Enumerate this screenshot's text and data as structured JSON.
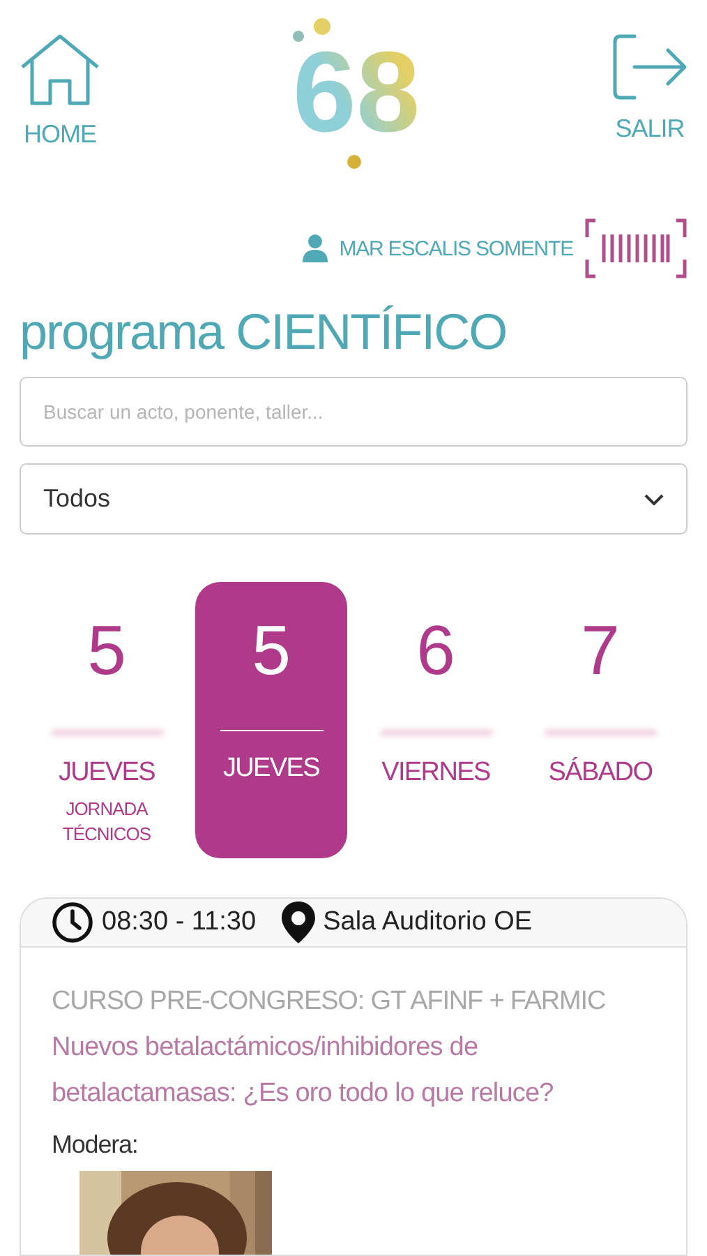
{
  "header": {
    "home_label": "HOME",
    "logo_text": "68",
    "exit_label": "SALIR"
  },
  "user": {
    "name": "MAR ESCALIS SOMENTE"
  },
  "title": "programa CIENTÍFICO",
  "search": {
    "placeholder": "Buscar un acto, ponente, taller..."
  },
  "filter": {
    "value": "Todos"
  },
  "days": [
    {
      "number": "5",
      "label": "JUEVES",
      "sublabel": "JORNADA TÉCNICOS",
      "selected": false
    },
    {
      "number": "5",
      "label": "JUEVES",
      "selected": true
    },
    {
      "number": "6",
      "label": "VIERNES",
      "selected": false
    },
    {
      "number": "7",
      "label": "SÁBADO",
      "selected": false
    }
  ],
  "session": {
    "time": "08:30 - 11:30",
    "room": "Sala Auditorio OE",
    "category": "CURSO PRE-CONGRESO: GT AFINF + FARMIC",
    "title": "Nuevos betalactámicos/inhibidores de betalactamasas: ¿Es oro todo lo que reluce?",
    "moderator_label": "Modera:"
  }
}
